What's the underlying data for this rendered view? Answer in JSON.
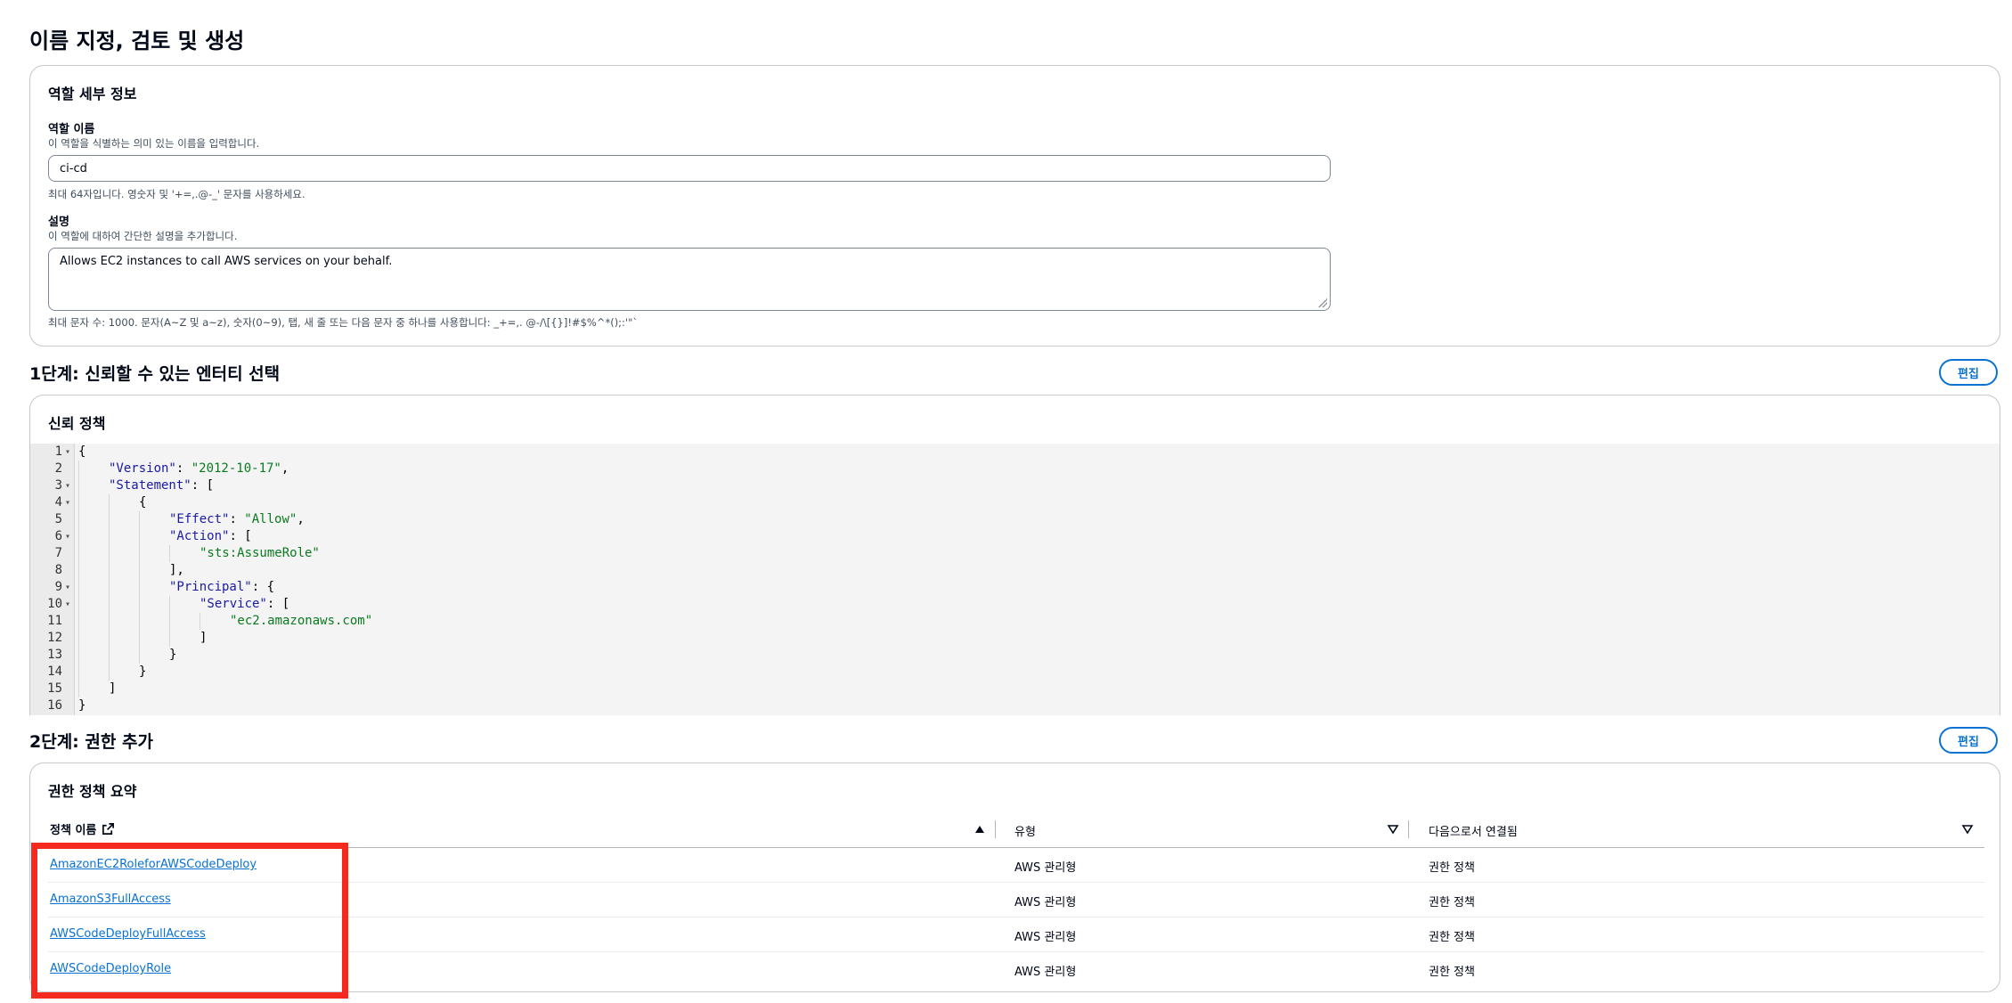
{
  "page_title": "이름 지정, 검토 및 생성",
  "role_details": {
    "title": "역할 세부 정보",
    "name_label": "역할 이름",
    "name_desc": "이 역할을 식별하는 의미 있는 이름을 입력합니다.",
    "name_value": "ci-cd",
    "name_hint": "최대 64자입니다. 영숫자 및 '+=,.@-_' 문자를 사용하세요.",
    "desc_label": "설명",
    "desc_desc": "이 역할에 대하여 간단한 설명을 추가합니다.",
    "desc_value": "Allows EC2 instances to call AWS services on your behalf.",
    "desc_hint": "최대 문자 수: 1000. 문자(A~Z 및 a~z), 숫자(0~9), 탭, 새 줄 또는 다음 문자 중 하나를 사용합니다: _+=,. @-/\\[{}]!#$%^*();:'\"`"
  },
  "step1": {
    "title": "1단계: 신뢰할 수 있는 엔터티 선택",
    "edit_label": "편집",
    "card_title": "신뢰 정책",
    "code_lines": [
      {
        "n": "1",
        "fold": true,
        "indent": 0,
        "tokens": [
          [
            "p",
            "{"
          ]
        ]
      },
      {
        "n": "2",
        "fold": false,
        "indent": 1,
        "tokens": [
          [
            "k",
            "\"Version\""
          ],
          [
            "p",
            ": "
          ],
          [
            "s",
            "\"2012-10-17\""
          ],
          [
            "p",
            ","
          ]
        ]
      },
      {
        "n": "3",
        "fold": true,
        "indent": 1,
        "tokens": [
          [
            "k",
            "\"Statement\""
          ],
          [
            "p",
            ": ["
          ]
        ]
      },
      {
        "n": "4",
        "fold": true,
        "indent": 2,
        "tokens": [
          [
            "p",
            "{"
          ]
        ]
      },
      {
        "n": "5",
        "fold": false,
        "indent": 3,
        "tokens": [
          [
            "k",
            "\"Effect\""
          ],
          [
            "p",
            ": "
          ],
          [
            "s",
            "\"Allow\""
          ],
          [
            "p",
            ","
          ]
        ]
      },
      {
        "n": "6",
        "fold": true,
        "indent": 3,
        "tokens": [
          [
            "k",
            "\"Action\""
          ],
          [
            "p",
            ": ["
          ]
        ]
      },
      {
        "n": "7",
        "fold": false,
        "indent": 4,
        "tokens": [
          [
            "s",
            "\"sts:AssumeRole\""
          ]
        ]
      },
      {
        "n": "8",
        "fold": false,
        "indent": 3,
        "tokens": [
          [
            "p",
            "],"
          ]
        ]
      },
      {
        "n": "9",
        "fold": true,
        "indent": 3,
        "tokens": [
          [
            "k",
            "\"Principal\""
          ],
          [
            "p",
            ": {"
          ]
        ]
      },
      {
        "n": "10",
        "fold": true,
        "indent": 4,
        "tokens": [
          [
            "k",
            "\"Service\""
          ],
          [
            "p",
            ": ["
          ]
        ]
      },
      {
        "n": "11",
        "fold": false,
        "indent": 5,
        "tokens": [
          [
            "s",
            "\"ec2.amazonaws.com\""
          ]
        ]
      },
      {
        "n": "12",
        "fold": false,
        "indent": 4,
        "tokens": [
          [
            "p",
            "]"
          ]
        ]
      },
      {
        "n": "13",
        "fold": false,
        "indent": 3,
        "tokens": [
          [
            "p",
            "}"
          ]
        ]
      },
      {
        "n": "14",
        "fold": false,
        "indent": 2,
        "tokens": [
          [
            "p",
            "}"
          ]
        ]
      },
      {
        "n": "15",
        "fold": false,
        "indent": 1,
        "tokens": [
          [
            "p",
            "]"
          ]
        ]
      },
      {
        "n": "16",
        "fold": false,
        "indent": 0,
        "tokens": [
          [
            "p",
            "}"
          ]
        ]
      }
    ]
  },
  "step2": {
    "title": "2단계: 권한 추가",
    "edit_label": "편집",
    "card_title": "권한 정책 요약",
    "columns": [
      "정책 이름",
      "유형",
      "다음으로서 연결됨"
    ],
    "rows": [
      {
        "name": "AmazonEC2RoleforAWSCodeDeploy",
        "type": "AWS 관리형",
        "attached": "권한 정책"
      },
      {
        "name": "AmazonS3FullAccess",
        "type": "AWS 관리형",
        "attached": "권한 정책"
      },
      {
        "name": "AWSCodeDeployFullAccess",
        "type": "AWS 관리형",
        "attached": "권한 정책"
      },
      {
        "name": "AWSCodeDeployRole",
        "type": "AWS 관리형",
        "attached": "권한 정책"
      }
    ]
  },
  "colors": {
    "link": "#0972d3",
    "highlight": "#f42a1f",
    "json_key": "#1a1aa6",
    "json_string": "#0a7a1f"
  },
  "icons": [
    "external-link-icon",
    "sort-ascending-icon",
    "sort-descending-icon",
    "fold-arrow-icon",
    "resize-grip-icon"
  ]
}
